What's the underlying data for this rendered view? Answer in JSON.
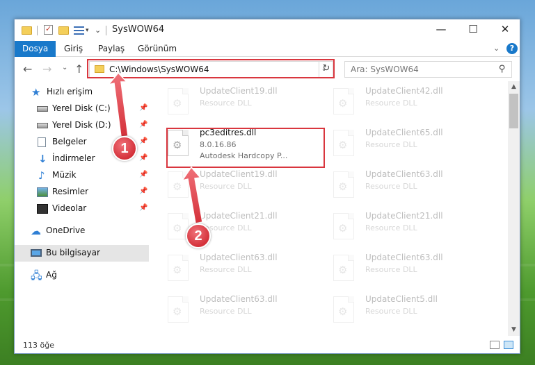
{
  "window": {
    "title": "SysWOW64",
    "controls": {
      "minimize": "—",
      "maximize": "☐",
      "close": "✕"
    }
  },
  "ribbon": {
    "tabs": [
      "Dosya",
      "Giriş",
      "Paylaş",
      "Görünüm"
    ],
    "active_tab": "Dosya",
    "help": "?"
  },
  "address": {
    "path": "C:\\Windows\\SysWOW64",
    "search_placeholder": "Ara: SysWOW64"
  },
  "sidebar": {
    "items": [
      {
        "label": "Hızlı erişim",
        "icon": "star-icon",
        "pinned": false
      },
      {
        "label": "Yerel Disk (C:)",
        "icon": "disk-icon",
        "pinned": true
      },
      {
        "label": "Yerel Disk (D:)",
        "icon": "disk-icon",
        "pinned": true
      },
      {
        "label": "Belgeler",
        "icon": "documents-icon",
        "pinned": true
      },
      {
        "label": "İndirmeler",
        "icon": "download-icon",
        "pinned": true
      },
      {
        "label": "Müzik",
        "icon": "music-icon",
        "pinned": true
      },
      {
        "label": "Resimler",
        "icon": "pictures-icon",
        "pinned": true
      },
      {
        "label": "Videolar",
        "icon": "video-icon",
        "pinned": true
      },
      {
        "label": "OneDrive",
        "icon": "cloud-icon",
        "pinned": false
      },
      {
        "label": "Bu bilgisayar",
        "icon": "computer-icon",
        "pinned": false,
        "selected": true
      },
      {
        "label": "Ağ",
        "icon": "network-icon",
        "pinned": false
      }
    ]
  },
  "files": [
    {
      "name": "UpdateClient19.dll",
      "type": "Resource DLL",
      "faded": true
    },
    {
      "name": "UpdateClient42.dll",
      "type": "Resource DLL",
      "faded": true
    },
    {
      "name": "pc3editres.dll",
      "version": "8.0.16.86",
      "description": "Autodesk Hardcopy P...",
      "faded": false
    },
    {
      "name": "UpdateClient65.dll",
      "type": "Resource DLL",
      "faded": true
    },
    {
      "name": "UpdateClient19.dll",
      "type": "Resource DLL",
      "faded": true
    },
    {
      "name": "UpdateClient63.dll",
      "type": "Resource DLL",
      "faded": true
    },
    {
      "name": "UpdateClient21.dll",
      "type": "Resource DLL",
      "faded": true
    },
    {
      "name": "UpdateClient21.dll",
      "type": "Resource DLL",
      "faded": true
    },
    {
      "name": "UpdateClient63.dll",
      "type": "Resource DLL",
      "faded": true
    },
    {
      "name": "UpdateClient63.dll",
      "type": "Resource DLL",
      "faded": true
    },
    {
      "name": "UpdateClient63.dll",
      "type": "Resource DLL",
      "faded": true
    },
    {
      "name": "UpdateClient5.dll",
      "type": "Resource DLL",
      "faded": true
    }
  ],
  "status": {
    "item_count": "113 öğe"
  },
  "annotations": {
    "step1": "1",
    "step2": "2",
    "accent_color": "#d9363e"
  }
}
